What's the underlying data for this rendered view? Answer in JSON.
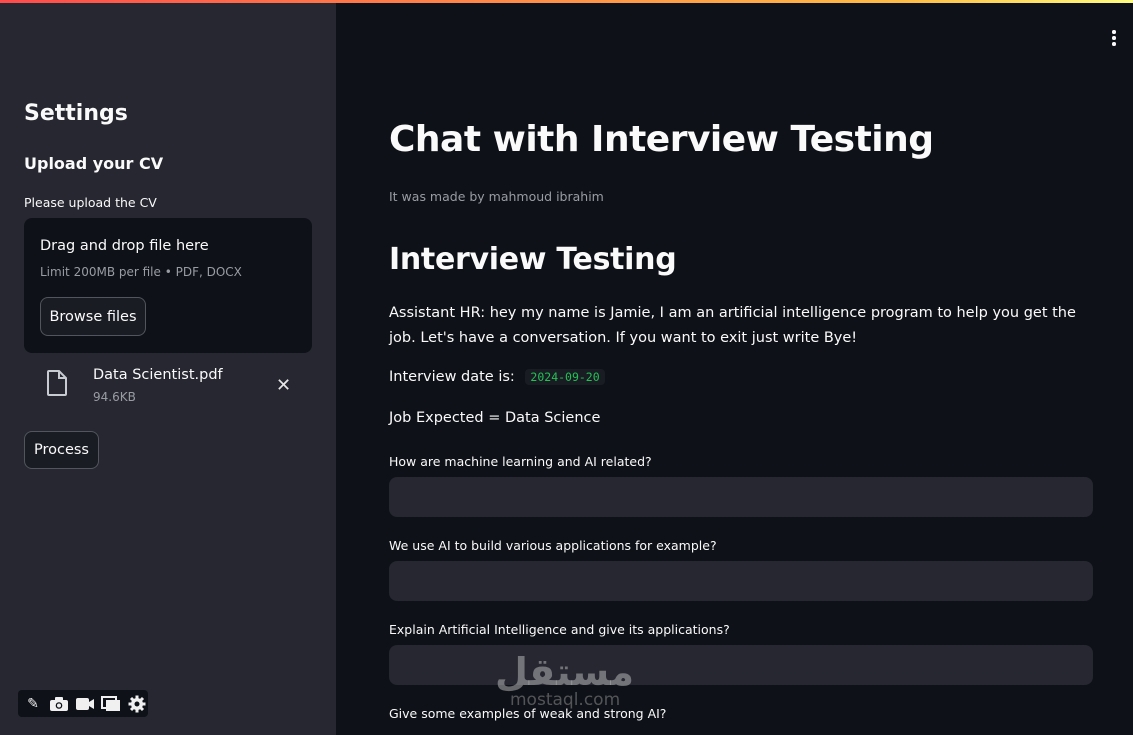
{
  "sidebar": {
    "title": "Settings",
    "upload_header": "Upload your CV",
    "upload_label": "Please upload the CV",
    "dropzone": {
      "title": "Drag and drop file here",
      "limit": "Limit 200MB per file • PDF, DOCX",
      "browse_label": "Browse files"
    },
    "file": {
      "name": "Data Scientist.pdf",
      "size": "94.6KB",
      "icon": "document-icon",
      "remove_icon": "close-icon"
    },
    "process_label": "Process"
  },
  "toolbar": {
    "icons": [
      "pen-icon",
      "camera-icon",
      "video-icon",
      "windows-icon",
      "gear-icon"
    ]
  },
  "main": {
    "title": "Chat with Interview Testing",
    "caption": "It was made by mahmoud ibrahim",
    "section_title": "Interview Testing",
    "assistant_message": "Assistant HR: hey my name is Jamie, I am an artificial intelligence program to help you get the job. Let's have a conversation. If you want to exit just write Bye!",
    "date_label": "Interview date is:",
    "date_value": "2024-09-20",
    "job_line": "Job Expected = Data Science",
    "questions": [
      {
        "label": "How are machine learning and AI related?",
        "value": ""
      },
      {
        "label": "We use AI to build various applications for example?",
        "value": ""
      },
      {
        "label": "Explain Artificial Intelligence and give its applications?",
        "value": ""
      },
      {
        "label": "Give some examples of weak and strong AI?",
        "value": ""
      }
    ]
  },
  "watermark": {
    "text": "مستقل",
    "sub": "mostaql.com"
  },
  "colors": {
    "main_bg": "#0e1117",
    "sidebar_bg": "#262730",
    "accent_gradient_start": "#ff4b4b",
    "code_text": "#21c354"
  }
}
